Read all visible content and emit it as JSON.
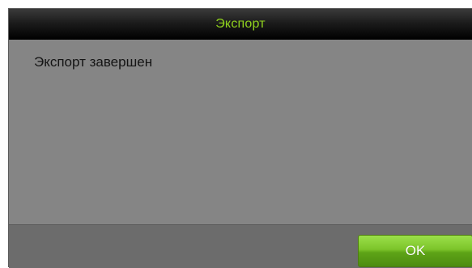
{
  "dialog": {
    "title": "Экспорт",
    "message": "Экспорт завершен",
    "ok_label": "OK"
  },
  "colors": {
    "title_text": "#8fd11d",
    "title_bar": "#000000",
    "content_bg": "#858585",
    "footer_bg": "#6c6c6c",
    "ok_button": "#6cb421"
  }
}
